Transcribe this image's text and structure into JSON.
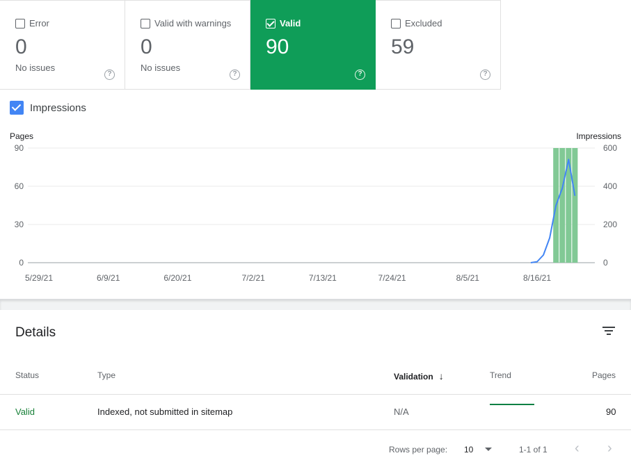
{
  "cards": [
    {
      "label": "Error",
      "count": "0",
      "sub": "No issues",
      "help": "?"
    },
    {
      "label": "Valid with warnings",
      "count": "0",
      "sub": "No issues",
      "help": "?"
    },
    {
      "label": "Valid",
      "count": "90",
      "sub": "",
      "help": "?"
    },
    {
      "label": "Excluded",
      "count": "59",
      "sub": "",
      "help": "?"
    }
  ],
  "impressions_toggle": {
    "label": "Impressions",
    "checked": true
  },
  "chart_data": {
    "type": "bar+line",
    "left_axis_label": "Pages",
    "right_axis_label": "Impressions",
    "left_ticks": [
      "90",
      "60",
      "30",
      "0"
    ],
    "right_ticks": [
      "600",
      "400",
      "200",
      "0"
    ],
    "x_ticks": [
      "5/29/21",
      "6/9/21",
      "6/20/21",
      "7/2/21",
      "7/13/21",
      "7/24/21",
      "8/5/21",
      "8/16/21"
    ],
    "ylim_left": [
      0,
      90
    ],
    "ylim_right": [
      0,
      600
    ],
    "bars": {
      "name": "Pages",
      "color": "#81c995",
      "dates": [
        "8/19/21",
        "8/20/21",
        "8/21/21",
        "8/22/21"
      ],
      "values": [
        90,
        90,
        90,
        90
      ]
    },
    "line": {
      "name": "Impressions",
      "color": "#4285f4",
      "dates": [
        "8/15/21",
        "8/16/21",
        "8/17/21",
        "8/18/21",
        "8/19/21",
        "8/20/21",
        "8/21/21",
        "8/22/21"
      ],
      "values": [
        0,
        5,
        40,
        130,
        300,
        390,
        540,
        350
      ]
    }
  },
  "details": {
    "title": "Details",
    "columns": {
      "status": "Status",
      "type": "Type",
      "validation": "Validation",
      "sort_arrow": "↓",
      "trend": "Trend",
      "pages": "Pages"
    },
    "rows": [
      {
        "status": "Valid",
        "type": "Indexed, not submitted in sitemap",
        "validation": "N/A",
        "pages": "90"
      }
    ]
  },
  "pagination": {
    "rows_per_page_label": "Rows per page:",
    "rows_per_page_value": "10",
    "range": "1-1 of 1",
    "prev": "‹",
    "next": "›"
  },
  "colors": {
    "valid_green": "#0f9d58",
    "impressions_blue": "#4285f4",
    "bar_green": "#81c995"
  }
}
